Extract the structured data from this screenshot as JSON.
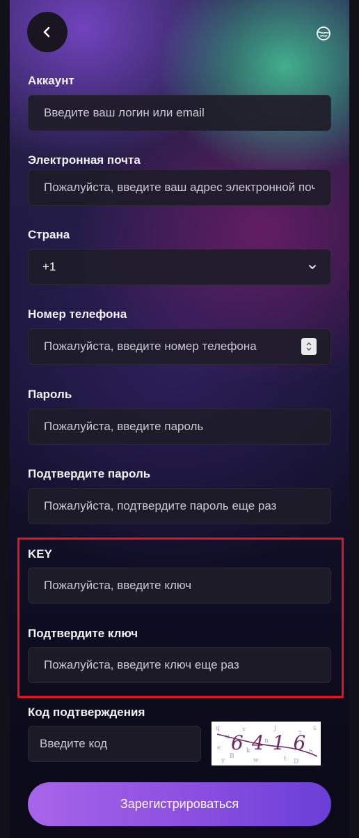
{
  "form": {
    "account": {
      "label": "Аккаунт",
      "placeholder": "Введите ваш логин или email"
    },
    "email": {
      "label": "Электронная почта",
      "placeholder": "Пожалуйста, введите ваш адрес электронной почты"
    },
    "country": {
      "label": "Страна",
      "value": "+1"
    },
    "phone": {
      "label": "Номер телефона",
      "placeholder": "Пожалуйста, введите номер телефона"
    },
    "password": {
      "label": "Пароль",
      "placeholder": "Пожалуйста, введите пароль"
    },
    "password_confirm": {
      "label": "Подтвердите пароль",
      "placeholder": "Пожалуйста, подтвердите пароль еще раз"
    },
    "key": {
      "label": "KEY",
      "placeholder": "Пожалуйста, введите ключ"
    },
    "key_confirm": {
      "label": "Подтвердите ключ",
      "placeholder": "Пожалуйста, введите ключ еще раз"
    },
    "code": {
      "label": "Код подтверждения",
      "placeholder": "Введите код"
    },
    "captcha_text": "6416",
    "submit_label": "Зарегистрироваться"
  },
  "icons": {
    "back": "chevron-left-icon",
    "language": "globe-icon",
    "dropdown": "chevron-down-icon",
    "stepper": "up-down-arrows-icon"
  },
  "colors": {
    "accent": "#8b4fe0",
    "highlight_border": "#e3141d",
    "field_bg": "#1e1c28"
  }
}
